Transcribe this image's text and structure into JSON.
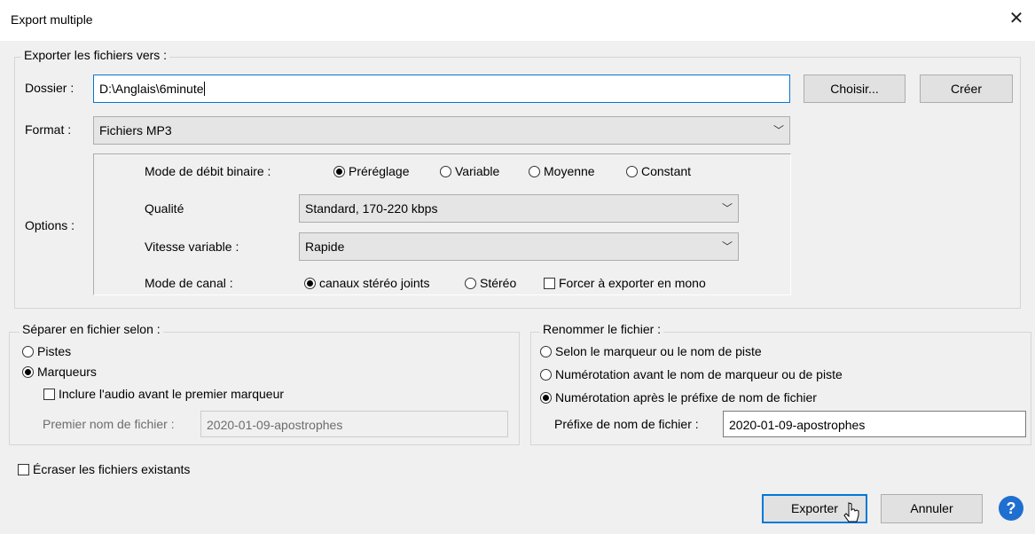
{
  "window": {
    "title": "Export multiple",
    "close": "✕"
  },
  "export_to": {
    "group_label": "Exporter les fichiers vers :",
    "folder_label": "Dossier :",
    "folder_value": "D:\\Anglais\\6minute",
    "choose_label": "Choisir...",
    "create_label": "Créer",
    "format_label": "Format :",
    "format_value": "Fichiers MP3",
    "options_label": "Options :",
    "bitrate_mode_label": "Mode de débit binaire :",
    "bitrate_modes": [
      "Préréglage",
      "Variable",
      "Moyenne",
      "Constant"
    ],
    "bitrate_selected": "Préréglage",
    "quality_label": "Qualité",
    "quality_value": "Standard, 170-220 kbps",
    "variable_speed_label": "Vitesse variable :",
    "variable_speed_value": "Rapide",
    "channel_mode_label": "Mode de canal :",
    "channel_modes": [
      "canaux stéréo joints",
      "Stéréo"
    ],
    "channel_selected": "canaux stéréo joints",
    "force_mono_label": "Forcer à exporter en mono",
    "force_mono_checked": false
  },
  "split": {
    "group_label": "Séparer en fichier selon :",
    "tracks_label": "Pistes",
    "markers_label": "Marqueurs",
    "selected": "Marqueurs",
    "include_audio_label": "Inclure l'audio avant le premier marqueur",
    "include_audio_checked": false,
    "first_file_label": "Premier nom de fichier :",
    "first_file_value": "2020-01-09-apostrophes"
  },
  "rename": {
    "group_label": "Renommer le fichier :",
    "options": [
      "Selon le marqueur ou le nom de piste",
      "Numérotation avant le nom de marqueur ou de piste",
      "Numérotation après le préfixe de nom de fichier"
    ],
    "selected_index": 2,
    "prefix_label": "Préfixe de nom de fichier :",
    "prefix_value": "2020-01-09-apostrophes"
  },
  "overwrite_label": "Écraser les fichiers existants",
  "overwrite_checked": false,
  "buttons": {
    "export": "Exporter",
    "cancel": "Annuler",
    "help": "?"
  },
  "icons": {
    "dropdown": "chevron-down-icon",
    "help": "help-icon",
    "cursor": "mouse-cursor-icon"
  },
  "colors": {
    "accent": "#0078d7",
    "help_blue": "#1f6fd0"
  }
}
